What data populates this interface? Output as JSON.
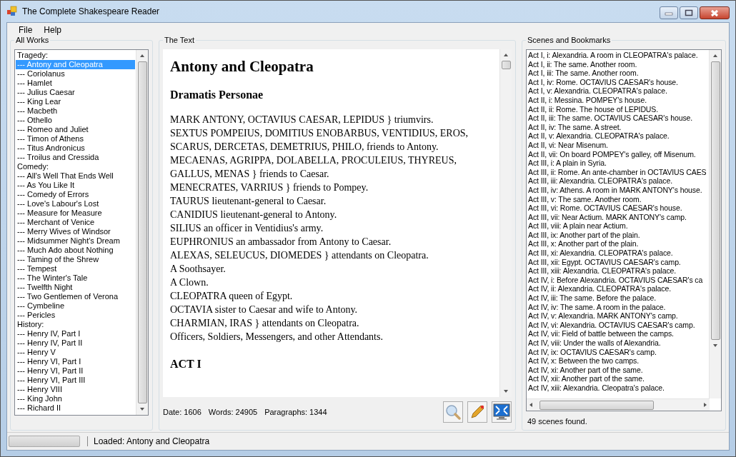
{
  "window": {
    "title": "The Complete Shakespeare Reader"
  },
  "menu": [
    {
      "label": "File"
    },
    {
      "label": "Help"
    }
  ],
  "works_panel": {
    "title": "All Works",
    "items": [
      {
        "label": "Tragedy:",
        "selected": false
      },
      {
        "label": "--- Antony and Cleopatra",
        "selected": true
      },
      {
        "label": "--- Coriolanus",
        "selected": false
      },
      {
        "label": "--- Hamlet",
        "selected": false
      },
      {
        "label": "--- Julius Caesar",
        "selected": false
      },
      {
        "label": "--- King Lear",
        "selected": false
      },
      {
        "label": "--- Macbeth",
        "selected": false
      },
      {
        "label": "--- Othello",
        "selected": false
      },
      {
        "label": "--- Romeo and Juliet",
        "selected": false
      },
      {
        "label": "--- Timon of Athens",
        "selected": false
      },
      {
        "label": "--- Titus Andronicus",
        "selected": false
      },
      {
        "label": "--- Troilus and Cressida",
        "selected": false
      },
      {
        "label": "Comedy:",
        "selected": false
      },
      {
        "label": "--- All's Well That Ends Well",
        "selected": false
      },
      {
        "label": "--- As You Like It",
        "selected": false
      },
      {
        "label": "--- Comedy of Errors",
        "selected": false
      },
      {
        "label": "--- Love's Labour's Lost",
        "selected": false
      },
      {
        "label": "--- Measure for Measure",
        "selected": false
      },
      {
        "label": "--- Merchant of Venice",
        "selected": false
      },
      {
        "label": "--- Merry Wives of Windsor",
        "selected": false
      },
      {
        "label": "--- Midsummer Night's Dream",
        "selected": false
      },
      {
        "label": "--- Much Ado about Nothing",
        "selected": false
      },
      {
        "label": "--- Taming of the Shrew",
        "selected": false
      },
      {
        "label": "--- Tempest",
        "selected": false
      },
      {
        "label": "--- The Winter's Tale",
        "selected": false
      },
      {
        "label": "--- Twelfth Night",
        "selected": false
      },
      {
        "label": "--- Two Gentlemen of Verona",
        "selected": false
      },
      {
        "label": "--- Cymbeline",
        "selected": false
      },
      {
        "label": "--- Pericles",
        "selected": false
      },
      {
        "label": "History:",
        "selected": false
      },
      {
        "label": "--- Henry IV, Part I",
        "selected": false
      },
      {
        "label": "--- Henry IV, Part II",
        "selected": false
      },
      {
        "label": "--- Henry V",
        "selected": false
      },
      {
        "label": "--- Henry VI, Part I",
        "selected": false
      },
      {
        "label": "--- Henry VI, Part II",
        "selected": false
      },
      {
        "label": "--- Henry VI, Part III",
        "selected": false
      },
      {
        "label": "--- Henry VIII",
        "selected": false
      },
      {
        "label": "--- King John",
        "selected": false
      },
      {
        "label": "--- Richard II",
        "selected": false
      }
    ]
  },
  "text_panel": {
    "title": "The Text",
    "document": {
      "title": "Antony and Cleopatra",
      "heading": "Dramatis Personae",
      "paragraphs": [
        "MARK ANTONY, OCTAVIUS CAESAR, LEPIDUS } triumvirs.",
        "SEXTUS POMPEIUS, DOMITIUS ENOBARBUS, VENTIDIUS, EROS, SCARUS, DERCETAS, DEMETRIUS, PHILO, friends to Antony.",
        "MECAENAS, AGRIPPA, DOLABELLA, PROCULEIUS, THYREUS, GALLUS, MENAS } friends to Caesar.",
        "MENECRATES, VARRIUS } friends to Pompey.",
        "TAURUS lieutenant-general to Caesar.",
        "CANIDIUS lieutenant-general to Antony.",
        "SILIUS an officer in Ventidius's army.",
        "EUPHRONIUS an ambassador from Antony to Caesar.",
        "ALEXAS, SELEUCUS, DIOMEDES } attendants on Cleopatra.",
        "A Soothsayer.",
        "A Clown.",
        "CLEOPATRA queen of Egypt.",
        "OCTAVIA sister to Caesar and wife to Antony.",
        "CHARMIAN, IRAS } attendants on Cleopatra.",
        "Officers, Soldiers, Messengers, and other Attendants."
      ],
      "act": "ACT I"
    },
    "info": [
      "Date: 1606",
      "Words: 24905",
      "Paragraphs: 1344"
    ]
  },
  "scenes_panel": {
    "title": "Scenes and Bookmarks",
    "scenes": [
      "Act I, i: Alexandria. A room in CLEOPATRA's palace.",
      "Act I, ii: The same. Another room.",
      "Act I, iii: The same. Another room.",
      "Act I, iv: Rome. OCTAVIUS CAESAR's house.",
      "Act I, v: Alexandria. CLEOPATRA's palace.",
      "Act II, i: Messina. POMPEY's house.",
      "Act II, ii: Rome. The house of LEPIDUS.",
      "Act II, iii: The same. OCTAVIUS CAESAR's house.",
      "Act II, iv: The same. A street.",
      "Act II, v: Alexandria. CLEOPATRA's palace.",
      "Act II, vi: Near Misenum.",
      "Act II, vii: On board POMPEY's galley, off Misenum.",
      "Act III, i: A plain in Syria.",
      "Act III, ii: Rome. An ante-chamber in OCTAVIUS CAES",
      "Act III, iii: Alexandria. CLEOPATRA's palace.",
      "Act III, iv: Athens. A room in MARK ANTONY's house.",
      "Act III, v: The same. Another room.",
      "Act III, vi: Rome. OCTAVIUS CAESAR's house.",
      "Act III, vii: Near Actium. MARK ANTONY's camp.",
      "Act III, viii: A plain near Actium.",
      "Act III, ix: Another part of the plain.",
      "Act III, x: Another part of the plain.",
      "Act III, xi: Alexandria. CLEOPATRA's palace.",
      "Act III, xii: Egypt. OCTAVIUS CAESAR's camp.",
      "Act III, xiii: Alexandria. CLEOPATRA's palace.",
      "Act IV, i: Before Alexandria. OCTAVIUS CAESAR's ca",
      "Act IV, ii: Alexandria. CLEOPATRA's palace.",
      "Act IV, iii: The same. Before the palace.",
      "Act IV, iv: The same. A room in the palace.",
      "Act IV, v: Alexandria. MARK ANTONY's camp.",
      "Act IV, vi: Alexandria. OCTAVIUS CAESAR's camp.",
      "Act IV, vii: Field of battle between the camps.",
      "Act IV, viii: Under the walls of Alexandria.",
      "Act IV, ix: OCTAVIUS CAESAR's camp.",
      "Act IV, x: Between the two camps.",
      "Act IV, xi: Another part of the same.",
      "Act IV, xii: Another part of the same.",
      "Act IV, xiii: Alexandria. Cleopatra's palace."
    ],
    "summary": "49 scenes found."
  },
  "status_bar": {
    "progress": {
      "level": 0
    },
    "message": "Loaded: Antony and Cleopatra"
  }
}
